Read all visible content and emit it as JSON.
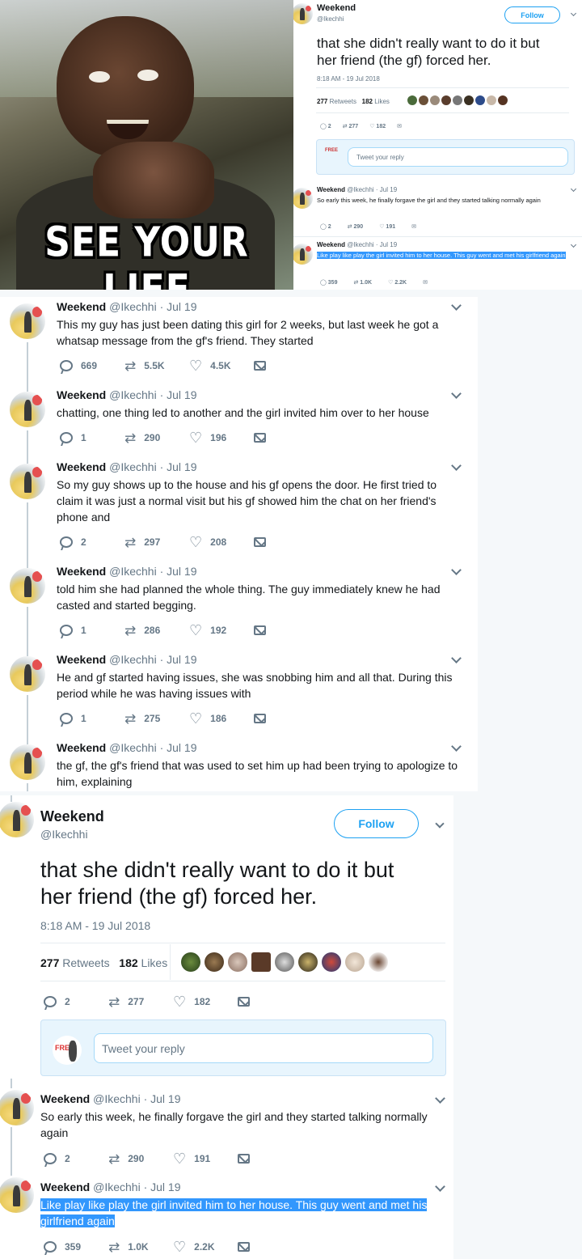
{
  "meme": {
    "caption": "SEE YOUR LIFE"
  },
  "main_tweet": {
    "name": "Weekend",
    "handle": "@Ikechhi",
    "follow_label": "Follow",
    "text_line1": "that she didn't really want to do it but",
    "text_line2": "her friend (the gf) forced her.",
    "time": "8:18 AM - 19 Jul 2018",
    "retweets_count": "277",
    "retweets_label": "Retweets",
    "likes_count": "182",
    "likes_label": "Likes",
    "reply_count": "2",
    "rt_count": "277",
    "like_count": "182",
    "reply_placeholder": "Tweet your reply",
    "reply_avatar_text": "FREE"
  },
  "followup_1": {
    "name": "Weekend",
    "handle": "@Ikechhi",
    "date": "· Jul 19",
    "text": "So early this week, he finally forgave the girl and they started talking normally again",
    "replies": "2",
    "retweets": "290",
    "likes": "191"
  },
  "followup_2": {
    "name": "Weekend",
    "handle": "@Ikechhi",
    "date": "· Jul 19",
    "text": "Like play like play the girl invited him to her house. This guy went and met his girlfriend again",
    "replies": "359",
    "retweets": "1.0K",
    "likes": "2.2K"
  },
  "thread": [
    {
      "name": "Weekend",
      "handle": "@Ikechhi",
      "date": "· Jul 19",
      "text": "This my guy has just been dating this girl for 2 weeks, but last week he got a whatsap message from the gf's friend. They started",
      "replies": "669",
      "retweets": "5.5K",
      "likes": "4.5K"
    },
    {
      "name": "Weekend",
      "handle": "@Ikechhi",
      "date": "· Jul 19",
      "text": "chatting, one thing led to another and the girl invited him over to her house",
      "replies": "1",
      "retweets": "290",
      "likes": "196"
    },
    {
      "name": "Weekend",
      "handle": "@Ikechhi",
      "date": "· Jul 19",
      "text": "So my guy shows up to the house and his gf opens the door. He first tried to claim it was just a normal visit but his gf showed him the chat on her friend's phone and",
      "replies": "2",
      "retweets": "297",
      "likes": "208"
    },
    {
      "name": "Weekend",
      "handle": "@Ikechhi",
      "date": "· Jul 19",
      "text": "told him she had planned the whole thing. The guy immediately knew he had casted and started begging.",
      "replies": "1",
      "retweets": "286",
      "likes": "192"
    },
    {
      "name": "Weekend",
      "handle": "@Ikechhi",
      "date": "· Jul 19",
      "text": "He and gf started having issues, she was snobbing him and all that. During this period while he was having issues with",
      "replies": "1",
      "retweets": "275",
      "likes": "186"
    },
    {
      "name": "Weekend",
      "handle": "@Ikechhi",
      "date": "· Jul 19",
      "text": "the gf, the gf's friend that was used to set him up had been trying to apologize to him, explaining"
    }
  ],
  "colors": {
    "accent": "#1da1f2",
    "muted": "#657786",
    "highlight": "#3297fd"
  }
}
